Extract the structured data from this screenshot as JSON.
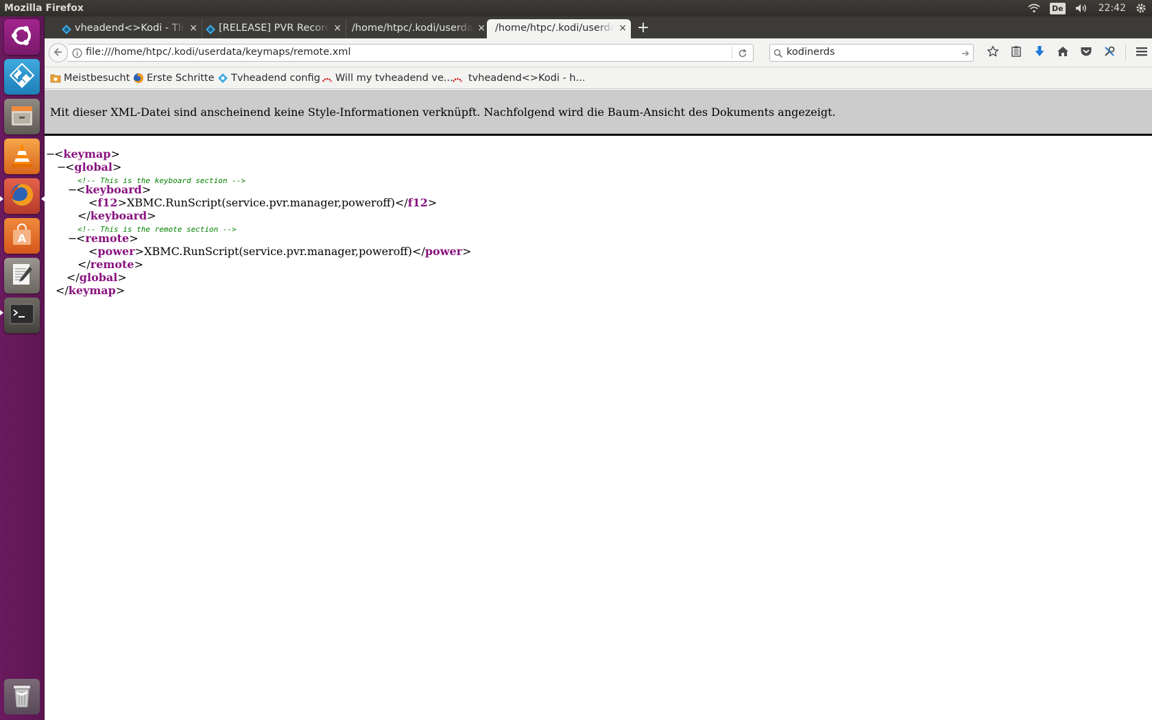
{
  "panel": {
    "app_title": "Mozilla Firefox",
    "keyboard_layout": "De",
    "clock": "22:42"
  },
  "launcher": {
    "items": [
      {
        "name": "ubuntu-dash"
      },
      {
        "name": "kodi"
      },
      {
        "name": "files"
      },
      {
        "name": "vlc"
      },
      {
        "name": "firefox"
      },
      {
        "name": "software-center"
      },
      {
        "name": "text-editor"
      },
      {
        "name": "terminal"
      },
      {
        "name": "trash"
      }
    ]
  },
  "tabs": [
    {
      "label": "vheadend<>Kodi - TIme",
      "close": "×"
    },
    {
      "label": "[RELEASE] PVR Record",
      "close": "×"
    },
    {
      "label": "/home/htpc/.kodi/userda",
      "close": "×"
    },
    {
      "label": "/home/htpc/.kodi/userda",
      "close": "×",
      "active": true
    }
  ],
  "new_tab": "+",
  "navbar": {
    "url": "file:///home/htpc/.kodi/userdata/keymaps/remote.xml",
    "search_value": "kodinerds"
  },
  "bookmarks": [
    {
      "label": "Meistbesucht"
    },
    {
      "label": "Erste Schritte"
    },
    {
      "label": "Tvheadend config"
    },
    {
      "label": "Will my tvheadend ve..."
    },
    {
      "label": "tvheadend<>Kodi - h..."
    }
  ],
  "xml_view": {
    "notice": "Mit dieser XML-Datei sind anscheinend keine Style-Informationen verknüpft. Nachfolgend wird die Baum-Ansicht des Dokuments angezeigt.",
    "collapse_glyph": "−",
    "lines": {
      "keymap_open": "keymap",
      "global_open": "global",
      "comment_keyboard": "<!-- This is the keyboard section -->",
      "keyboard_open": "keyboard",
      "f12_tag": "f12",
      "f12_value": "XBMC.RunScript(service.pvr.manager,poweroff)",
      "keyboard_close": "keyboard",
      "comment_remote": "<!-- This is the remote section -->",
      "remote_open": "remote",
      "power_tag": "power",
      "power_value": "XBMC.RunScript(service.pvr.manager,poweroff)",
      "remote_close": "remote",
      "global_close": "global",
      "keymap_close": "keymap"
    }
  },
  "colors": {
    "launcher_bg": "#6a1a5e",
    "xml_tag": "#881280",
    "xml_comment": "#008000",
    "header_bg": "#cccccc"
  }
}
